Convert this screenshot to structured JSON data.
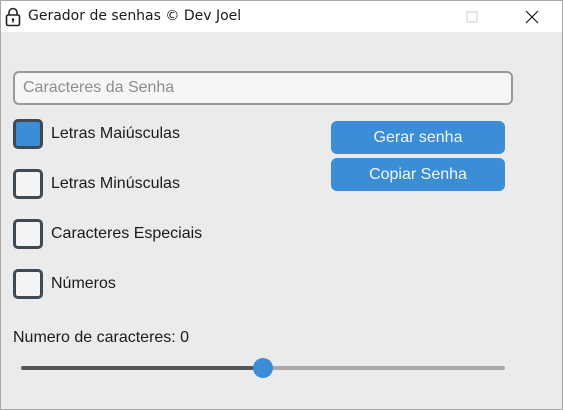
{
  "window": {
    "title": "Gerador de senhas © Dev Joel",
    "icons": {
      "app": "padlock-icon",
      "minimize": "minimize-icon",
      "maximize": "maximize-icon",
      "close": "close-icon"
    }
  },
  "password_field": {
    "placeholder": "Caracteres da Senha",
    "value": ""
  },
  "options": [
    {
      "label": "Letras Maiúsculas",
      "checked": true
    },
    {
      "label": "Letras Minúsculas",
      "checked": false
    },
    {
      "label": "Caracteres Especiais",
      "checked": false
    },
    {
      "label": "Números",
      "checked": false
    }
  ],
  "buttons": {
    "generate": "Gerar senha",
    "copy": "Copiar Senha"
  },
  "length": {
    "label": "Numero de caracteres: 0",
    "slider_fraction": 0.5
  },
  "colors": {
    "accent": "#3b8ed5",
    "checkbox_border": "#3f4a55",
    "background": "#ebebeb"
  }
}
